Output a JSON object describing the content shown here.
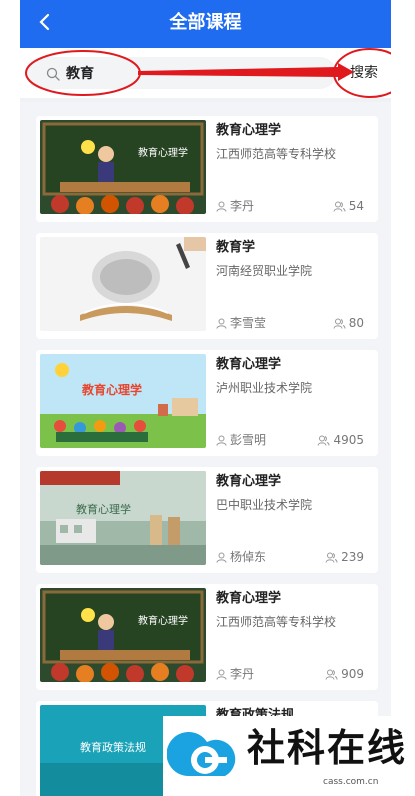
{
  "header": {
    "title": "全部课程",
    "back_icon": "chevron-left-icon"
  },
  "search": {
    "value": "教育",
    "button_label": "搜索",
    "icon": "search-icon"
  },
  "courses": [
    {
      "title": "教育心理学",
      "school": "江西师范高等专科学校",
      "teacher": "李丹",
      "count": "54"
    },
    {
      "title": "教育学",
      "school": "河南经贸职业学院",
      "teacher": "李雪莹",
      "count": "80"
    },
    {
      "title": "教育心理学",
      "school": "泸州职业技术学院",
      "teacher": "彭雪明",
      "count": "4905"
    },
    {
      "title": "教育心理学",
      "school": "巴中职业技术学院",
      "teacher": "杨倬东",
      "count": "239"
    },
    {
      "title": "教育心理学",
      "school": "江西师范高等专科学校",
      "teacher": "李丹",
      "count": "909"
    },
    {
      "title": "教育政策法规"
    }
  ],
  "thumbs": {
    "board_text": "教育心理学",
    "landscape_text": "教育心理学",
    "policy_text": "教育政策法规"
  },
  "watermark": {
    "text": "社科在线",
    "sub": "cass.com.cn"
  },
  "colors": {
    "header": "#1f6cf0",
    "annotation": "#e0191e"
  }
}
